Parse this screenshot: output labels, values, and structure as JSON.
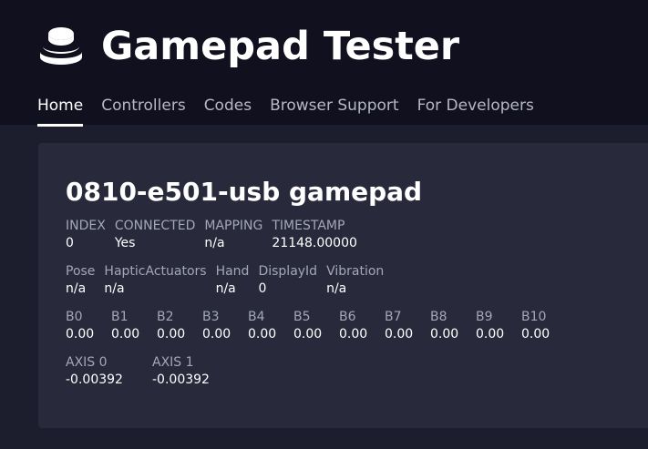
{
  "header": {
    "title": "Gamepad Tester",
    "logo_icon": "stacked-coins-icon",
    "nav": [
      {
        "label": "Home",
        "active": true
      },
      {
        "label": "Controllers",
        "active": false
      },
      {
        "label": "Codes",
        "active": false
      },
      {
        "label": "Browser Support",
        "active": false
      },
      {
        "label": "For Developers",
        "active": false
      }
    ]
  },
  "gamepad": {
    "name": "0810-e501-usb gamepad",
    "info": [
      {
        "label": "INDEX",
        "value": "0"
      },
      {
        "label": "CONNECTED",
        "value": "Yes"
      },
      {
        "label": "MAPPING",
        "value": "n/a"
      },
      {
        "label": "TIMESTAMP",
        "value": "21148.00000"
      }
    ],
    "features": [
      {
        "label": "Pose",
        "value": "n/a"
      },
      {
        "label": "HapticActuators",
        "value": "n/a"
      },
      {
        "label": "Hand",
        "value": "n/a"
      },
      {
        "label": "DisplayId",
        "value": "0"
      },
      {
        "label": "Vibration",
        "value": "n/a"
      }
    ],
    "buttons": [
      {
        "label": "B0",
        "value": "0.00"
      },
      {
        "label": "B1",
        "value": "0.00"
      },
      {
        "label": "B2",
        "value": "0.00"
      },
      {
        "label": "B3",
        "value": "0.00"
      },
      {
        "label": "B4",
        "value": "0.00"
      },
      {
        "label": "B5",
        "value": "0.00"
      },
      {
        "label": "B6",
        "value": "0.00"
      },
      {
        "label": "B7",
        "value": "0.00"
      },
      {
        "label": "B8",
        "value": "0.00"
      },
      {
        "label": "B9",
        "value": "0.00"
      },
      {
        "label": "B10",
        "value": "0.00"
      }
    ],
    "axes": [
      {
        "label": "AXIS 0",
        "value": "-0.00392"
      },
      {
        "label": "AXIS 1",
        "value": "-0.00392"
      }
    ]
  },
  "colors": {
    "page_bg": "#1d1e2d",
    "header_bg": "#10101f",
    "card_bg": "#282a3b",
    "label": "#a4a7b6",
    "nav_inactive": "#b6b8c6"
  }
}
